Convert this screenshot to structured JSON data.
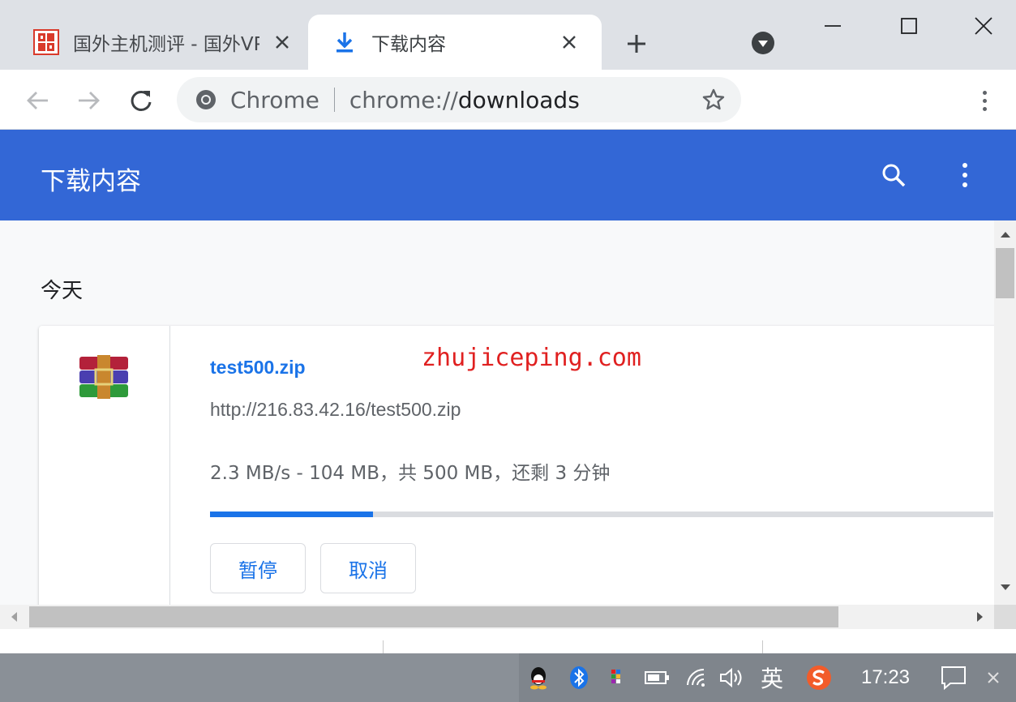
{
  "tabs": [
    {
      "title": "国外主机测评 - 国外VPS",
      "active": false
    },
    {
      "title": "下载内容",
      "active": true
    }
  ],
  "omnibox": {
    "site_name": "Chrome",
    "url_scheme": "chrome://",
    "url_path": "downloads"
  },
  "downloads_page": {
    "title": "下载内容",
    "date_group": "今天",
    "item": {
      "file_name": "test500.zip",
      "url": "http://216.83.42.16/test500.zip",
      "status": "2.3 MB/s - 104 MB，共 500 MB，还剩 3 分钟",
      "progress_fraction": 0.208,
      "pause_label": "暂停",
      "cancel_label": "取消"
    }
  },
  "watermark": "zhujiceping.com",
  "taskbar": {
    "ime_label": "英",
    "clock": "17:23"
  },
  "colors": {
    "header_blue": "#3367d6",
    "link_blue": "#1a73e8",
    "watermark_red": "#e02020"
  }
}
